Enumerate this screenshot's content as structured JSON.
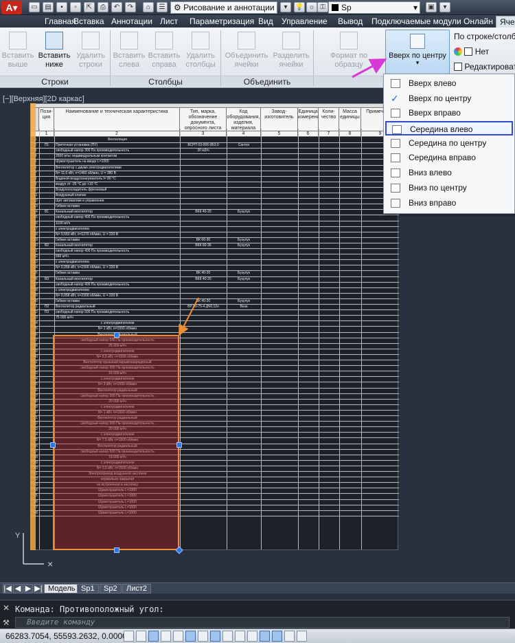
{
  "titlebar": {
    "workspace": "Рисование и аннотации",
    "layer": "Sp"
  },
  "tabs": [
    "Главная",
    "Вставка",
    "Аннотации",
    "Лист",
    "Параметризация",
    "Вид",
    "Управление",
    "Вывод",
    "Подключаемые модули",
    "Онлайн",
    "Яче"
  ],
  "ribbon": {
    "rows": {
      "insert_above": "Вставить выше",
      "insert_below": "Вставить ниже",
      "delete_rows": "Удалить строки",
      "label": "Строки"
    },
    "cols": {
      "insert_left": "Вставить слева",
      "insert_right": "Вставить справа",
      "delete_cols": "Удалить столбцы",
      "label": "Столбцы"
    },
    "merge": {
      "merge_cells": "Объединить ячейки",
      "unmerge_cells": "Разделить ячейки",
      "label": "Объединить"
    },
    "format_painter": "Формат по образцу",
    "align_button": "Вверх по центру",
    "by_row_col": "По строке/столбцу",
    "none_label": "Нет",
    "edit_label": "Редактироват"
  },
  "align_menu": [
    {
      "label": "Вверх влево"
    },
    {
      "label": "Вверх по центру",
      "checked": "✓"
    },
    {
      "label": "Вверх вправо"
    },
    {
      "label": "Середина влево"
    },
    {
      "label": "Середина по центру"
    },
    {
      "label": "Середина вправо"
    },
    {
      "label": "Вниз влево"
    },
    {
      "label": "Вниз по центру"
    },
    {
      "label": "Вниз вправо"
    }
  ],
  "viewport_label": "[−][Верхняя][2D каркас]",
  "table": {
    "headers": [
      "Пози-ция",
      "Наименование и техническая характеристика",
      "Тип, марка, обозначение документа, опросного листа",
      "Код оборудования, изделия, материала",
      "Завод-изготовитель",
      "Единица измерения",
      "Коли-чество",
      "Масса единицы",
      "Примечание"
    ],
    "col_numbers": [
      "1",
      "2",
      "3",
      "4",
      "5",
      "6",
      "7",
      "8",
      "9"
    ],
    "first_row": "Вентиляция",
    "rows": [
      {
        "pos": "П1",
        "name": "Приточная установка (ПУ) ",
        "type": "ВСРП 03-006-0Б3.0",
        "code": "Сантех"
      },
      {
        "pos": "",
        "name": "свободный напор 300 Па производительность",
        "type": "20 м3/ч"
      },
      {
        "pos": "",
        "name": "2600 м³ьс индивидуальным контактом"
      },
      {
        "pos": "",
        "name": "Шумоглушитель на вводе L=1000"
      },
      {
        "pos": "",
        "name": "Вентилятор с двумя электродвигателями"
      },
      {
        "pos": "",
        "name": "N= 11,0 кВт, n=1460 об/мин, U = 380 В"
      },
      {
        "pos": "",
        "name": "Водяной воздухонагреватель t= 80 °С"
      },
      {
        "pos": "",
        "name": "воздух от -26 °С до +10 °С"
      },
      {
        "pos": "",
        "name": "Воздухоохладитель фреоновый"
      },
      {
        "pos": "",
        "name": "Воздушный клапан"
      },
      {
        "pos": "",
        "name": "Щит автоматики и управления"
      },
      {
        "pos": "",
        "name": "Гибкие вставки"
      },
      {
        "pos": "В1",
        "name": "Канальный вентилятор",
        "type": "ВКК 40-20",
        "code": "Бузулук"
      },
      {
        "pos": "",
        "name": "свободный напор 400 Па производительность"
      },
      {
        "pos": "",
        "name": "1100 м³/ч"
      },
      {
        "pos": "",
        "name": "с электродвигателем"
      },
      {
        "pos": "",
        "name": "N= 0,550 кВт, n=1370 об/мин, U = 220 В"
      },
      {
        "pos": "",
        "name": "Гибкие вставки",
        "type": "ВК 60-35",
        "code": "Бузулук"
      },
      {
        "pos": "В2",
        "name": "Канальный вентилятор",
        "type": "ВКК 60-35",
        "code": "Бузулук"
      },
      {
        "pos": "",
        "name": "свободный напор 400 Па производительность"
      },
      {
        "pos": "",
        "name": "560 м³/ч"
      },
      {
        "pos": "",
        "name": "с электродвигателем"
      },
      {
        "pos": "",
        "name": "N= 0,058 кВт, n=2300 об/мин, U = 220 В"
      },
      {
        "pos": "",
        "name": "Гибкие вставки",
        "type": "ВК 40-20",
        "code": "Бузулук"
      },
      {
        "pos": "В3",
        "name": "Канальный вентилятор",
        "type": "ВКК 40-20",
        "code": "Бузулук"
      },
      {
        "pos": "",
        "name": "свободный напор 400 Па производительность"
      },
      {
        "pos": "",
        "name": "с электродвигателем"
      },
      {
        "pos": "",
        "name": "N= 0,058 кВт, n=2300 об/мин, U = 220 В"
      },
      {
        "pos": "",
        "name": "Гибкие вставки",
        "type": "ВК 40-20",
        "code": "Бузулук"
      },
      {
        "pos": "П2",
        "name": "Вентилятор радиальный",
        "type": "ВР 80-75-4 ДЧ0,12н",
        "code": "Веза"
      },
      {
        "pos": "П3",
        "name": "свободный напор 500 Па производительность"
      },
      {
        "pos": "",
        "name": "75 000 м³/ч"
      }
    ],
    "sel_rows": [
      "с электродвигателем",
      "N= 1 кВт, n=1500 об/мин",
      "Вентилятор радиальный",
      "свободный напор 640 Па производительность",
      "25 000 м³/ч",
      "с электродвигателем",
      "N= 5,5 кВт, n=1500 об/мин",
      "Вентилятор крышный взрывозащищенный",
      "свободный напор 500 Па производительность",
      "16 000 м³/ч",
      "с электродвигателем",
      "N= 3 кВт, n=1500 об/мин",
      "Вентилятор радиальный",
      "свободный напор 500 Па производительность",
      "20 000 м³/ч",
      "с электродвигателем",
      "N= 1 кВт, n=1500 об/мин",
      "Вентилятор радиальный",
      "свободный напор 500 Па производительность",
      "20 000 м³/ч",
      "с электродвигателем",
      "N= 7,5 кВт, n=1500 об/мин",
      "Вентилятор радиальный",
      "свободный напор 500 Па производительность",
      "19 000 м³/ч",
      "с электродвигателем",
      "N= 3,0 кВт, n=1500 об/мин",
      "Электропривод воздушной заслонки",
      "нормально-закрытая",
      "не встроенная в заслонку",
      "Шумоглушитель L=1000",
      "Шумоглушитель L=1000",
      "Шумоглушитель L=1000",
      "Шумоглушитель L=1000",
      "Шумоглушитель L=1000"
    ]
  },
  "layout_tabs": [
    "Модель",
    "Sp1",
    "Sp2",
    "Лист2"
  ],
  "command": {
    "line": "Команда: Противоположный угол:",
    "placeholder": "Введите команду"
  },
  "status": {
    "coords": "66283.7054, 55593.2632, 0.0000"
  },
  "colors": {
    "accent": "#2f4bd6",
    "selection": "#f08c33",
    "app_red": "#c8261c",
    "arrow_magenta": "#d63ad6",
    "arrow_blue": "#3a3ae0"
  }
}
